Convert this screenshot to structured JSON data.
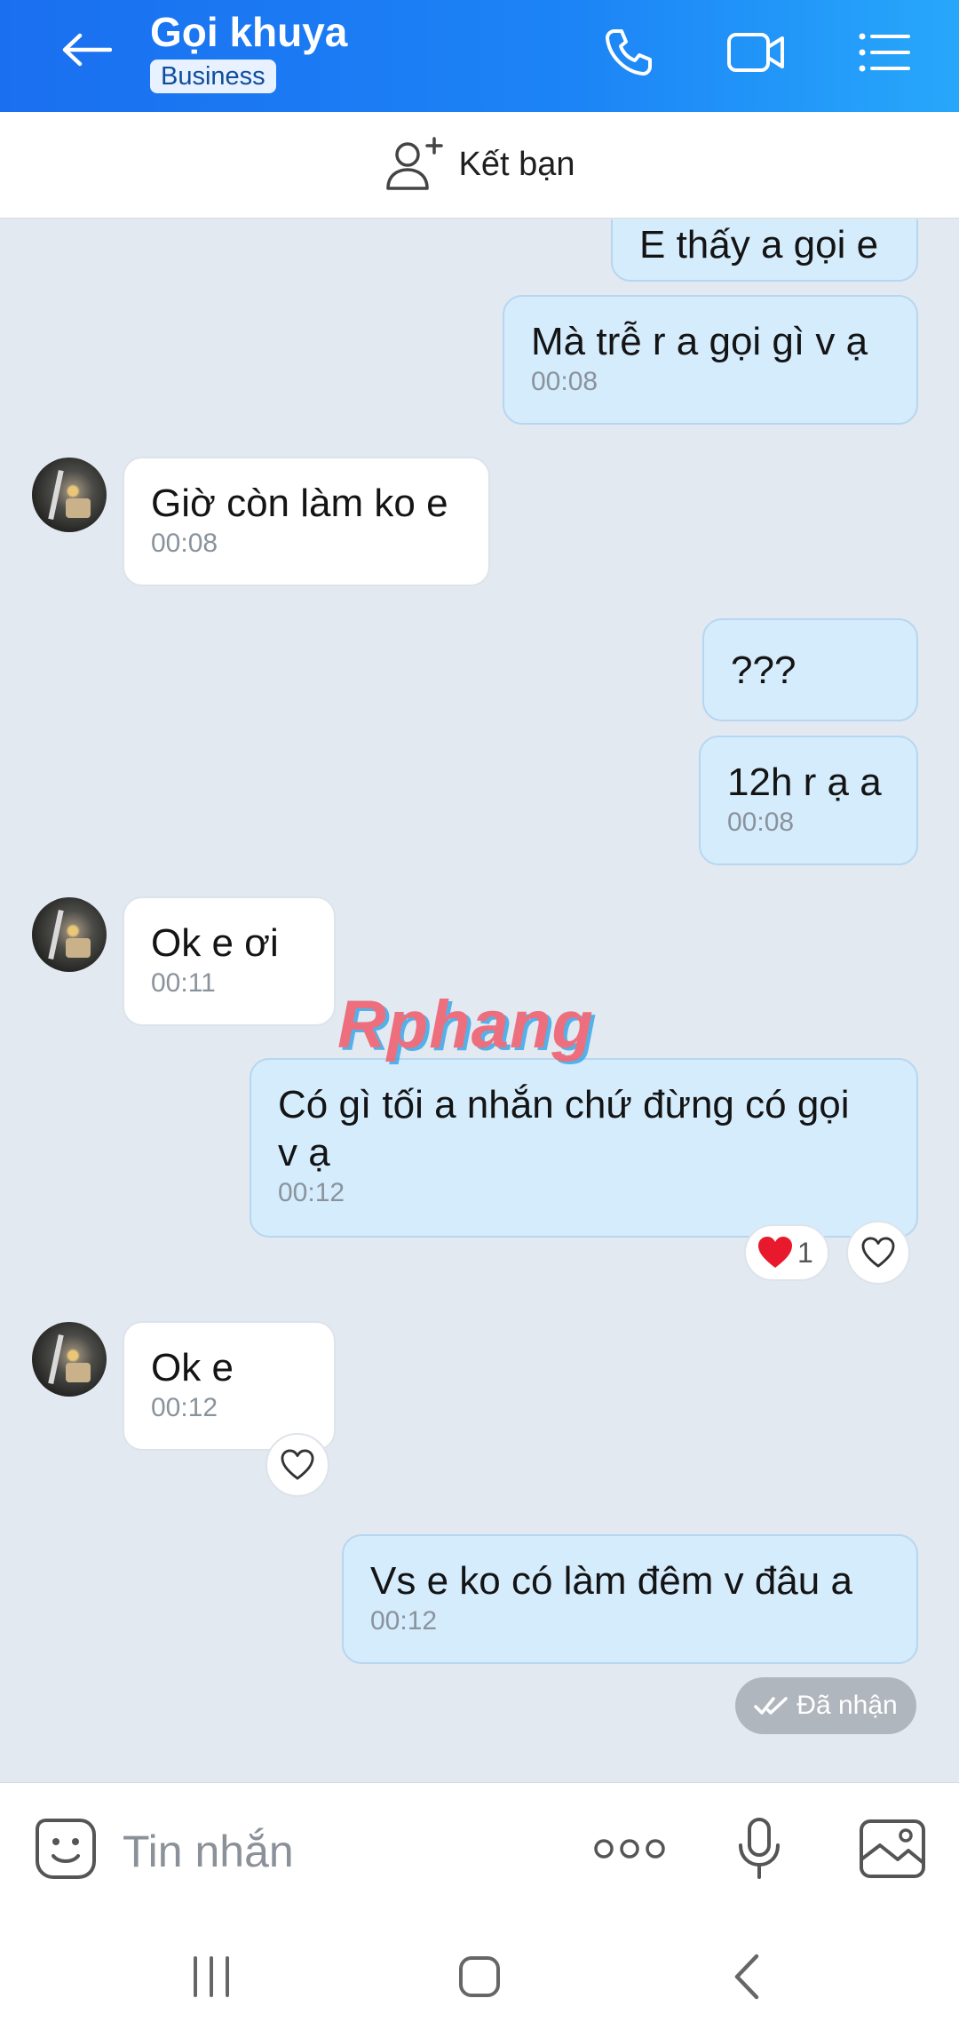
{
  "header": {
    "title": "Gọi khuya",
    "badge": "Business",
    "icons": [
      "back-arrow-icon",
      "phone-icon",
      "video-call-icon",
      "list-menu-icon"
    ],
    "bg_colors": [
      "#1a6ff0",
      "#27a7fb"
    ]
  },
  "add_friend": {
    "label": "Kết bạn",
    "icon": "add-person-icon"
  },
  "messages": [
    {
      "side": "me",
      "text": "E thấy a gọi e",
      "time": ""
    },
    {
      "side": "me",
      "text": "Mà trễ r a gọi gì v ạ",
      "time": "00:08"
    },
    {
      "side": "them",
      "text": "Giờ còn làm ko e",
      "time": "00:08"
    },
    {
      "side": "me",
      "text": "???",
      "time": ""
    },
    {
      "side": "me",
      "text": "12h r ạ a",
      "time": "00:08"
    },
    {
      "side": "them",
      "text": "Ok e ơi",
      "time": "00:11"
    },
    {
      "side": "me",
      "text": "Có gì tối a nhắn chứ đừng có gọi",
      "text2": "v ạ",
      "time": "00:12",
      "reaction_count": "1"
    },
    {
      "side": "them",
      "text": "Ok e",
      "time": "00:12"
    },
    {
      "side": "me",
      "text": "Vs e ko có làm đêm v đâu a",
      "time": "00:12"
    }
  ],
  "status": {
    "received": "Đã nhận"
  },
  "watermark": "Rphang",
  "composer": {
    "placeholder": "Tin nhắn",
    "icons": [
      "sticker-icon",
      "more-icon",
      "microphone-icon",
      "image-icon"
    ]
  },
  "system_nav": {
    "icons": [
      "recents-icon",
      "home-icon",
      "back-icon"
    ]
  },
  "colors": {
    "my_bubble": "#d5ecfd",
    "their_bubble": "#ffffff",
    "chat_bg": "#e2e9f1",
    "heart": "#e8192c"
  }
}
